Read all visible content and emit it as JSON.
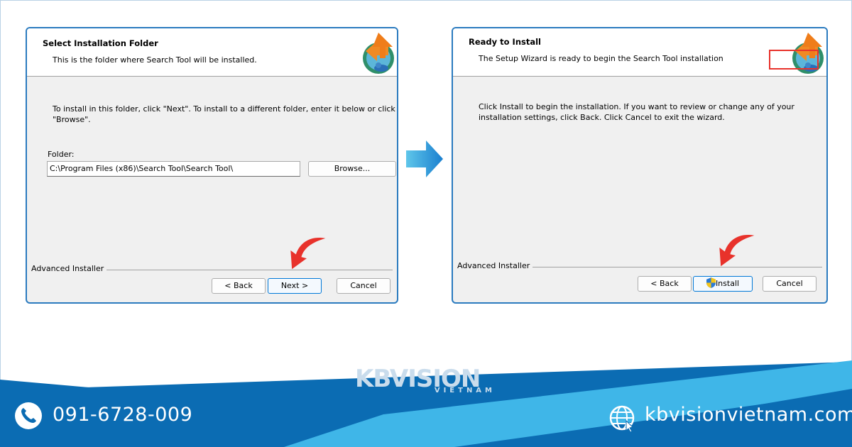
{
  "left_dialog": {
    "title": "Select Installation Folder",
    "subtitle": "This is the folder where Search Tool will be installed.",
    "instruction_line1": "To install in this folder, click \"Next\". To install to a different folder, enter it below or click",
    "instruction_line2": "\"Browse\".",
    "folder_label": "Folder:",
    "folder_value": "C:\\Program Files (x86)\\Search Tool\\Search Tool\\",
    "browse_label": "Browse...",
    "branding": "Advanced Installer",
    "back_label": "< Back",
    "next_label": "Next >",
    "cancel_label": "Cancel"
  },
  "right_dialog": {
    "title": "Ready to Install",
    "subtitle": "The Setup Wizard is ready to begin the Search Tool installation",
    "body_line1": "Click Install to begin the installation.  If you want to review or change any of your",
    "body_line2": "installation settings, click Back.  Click Cancel to exit the wizard.",
    "branding": "Advanced Installer",
    "back_label": "< Back",
    "install_label": "Install",
    "cancel_label": "Cancel"
  },
  "footer": {
    "brand_main": "KBVISION",
    "brand_sub": "VIETNAM",
    "phone": "091-6728-009",
    "website": "kbvisionvietnam.com"
  },
  "colors": {
    "accent_blue": "#0b6cb3",
    "light_blue": "#3fb6e8",
    "window_border": "#2b7bbf",
    "arrow_red": "#e8322b"
  },
  "icons": [
    "installer-logo-icon",
    "arrow-right-icon",
    "red-pointer-arrow-icon",
    "shield-icon",
    "phone-icon",
    "globe-icon"
  ]
}
